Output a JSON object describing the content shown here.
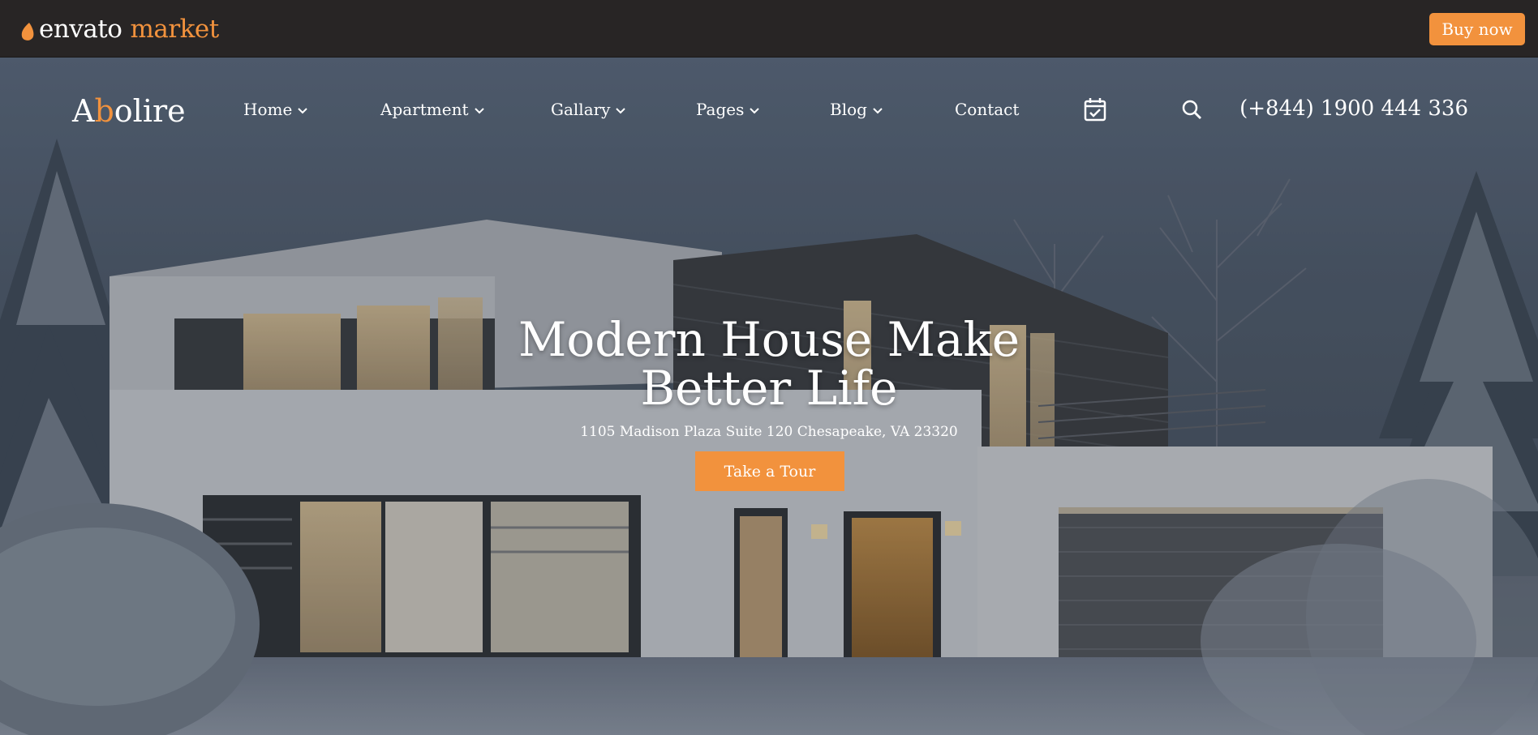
{
  "envato_bar": {
    "logo_text": "envato",
    "logo_market": "market",
    "buy_label": "Buy now"
  },
  "site": {
    "brand_first": "A",
    "brand_accent": "b",
    "brand_rest": "olire",
    "nav": [
      {
        "label": "Home"
      },
      {
        "label": "Apartment"
      },
      {
        "label": "Gallary"
      },
      {
        "label": "Pages"
      },
      {
        "label": "Blog"
      },
      {
        "label": "Contact"
      }
    ],
    "phone": "(+844) 1900 444 336"
  },
  "hero": {
    "title_line1": "Modern House Make",
    "title_line2": "Better Life",
    "address": "1105 Madison Plaza Suite 120 Chesapeake, VA 23320",
    "cta_label": "Take a Tour"
  },
  "icons": {
    "calendar": "calendar-check-icon",
    "search": "search-icon",
    "chevron": "chevron-down-icon"
  },
  "colors": {
    "accent": "#f2923d",
    "topbar": "#282525",
    "text": "#ffffff"
  }
}
